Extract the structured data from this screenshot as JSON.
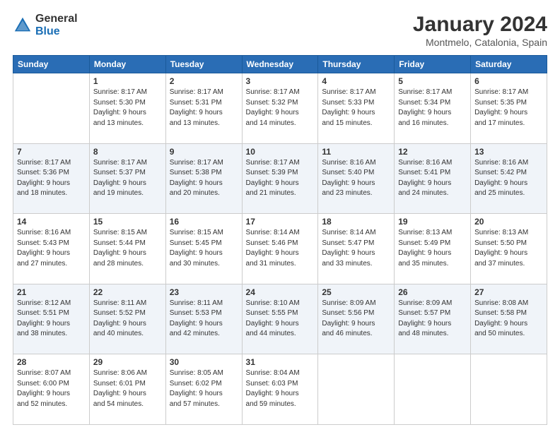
{
  "logo": {
    "general": "General",
    "blue": "Blue"
  },
  "title": "January 2024",
  "subtitle": "Montmelo, Catalonia, Spain",
  "days_header": [
    "Sunday",
    "Monday",
    "Tuesday",
    "Wednesday",
    "Thursday",
    "Friday",
    "Saturday"
  ],
  "weeks": [
    [
      {
        "num": "",
        "sunrise": "",
        "sunset": "",
        "daylight": "",
        "empty": true
      },
      {
        "num": "1",
        "sunrise": "Sunrise: 8:17 AM",
        "sunset": "Sunset: 5:30 PM",
        "daylight": "Daylight: 9 hours and 13 minutes."
      },
      {
        "num": "2",
        "sunrise": "Sunrise: 8:17 AM",
        "sunset": "Sunset: 5:31 PM",
        "daylight": "Daylight: 9 hours and 13 minutes."
      },
      {
        "num": "3",
        "sunrise": "Sunrise: 8:17 AM",
        "sunset": "Sunset: 5:32 PM",
        "daylight": "Daylight: 9 hours and 14 minutes."
      },
      {
        "num": "4",
        "sunrise": "Sunrise: 8:17 AM",
        "sunset": "Sunset: 5:33 PM",
        "daylight": "Daylight: 9 hours and 15 minutes."
      },
      {
        "num": "5",
        "sunrise": "Sunrise: 8:17 AM",
        "sunset": "Sunset: 5:34 PM",
        "daylight": "Daylight: 9 hours and 16 minutes."
      },
      {
        "num": "6",
        "sunrise": "Sunrise: 8:17 AM",
        "sunset": "Sunset: 5:35 PM",
        "daylight": "Daylight: 9 hours and 17 minutes."
      }
    ],
    [
      {
        "num": "7",
        "sunrise": "Sunrise: 8:17 AM",
        "sunset": "Sunset: 5:36 PM",
        "daylight": "Daylight: 9 hours and 18 minutes."
      },
      {
        "num": "8",
        "sunrise": "Sunrise: 8:17 AM",
        "sunset": "Sunset: 5:37 PM",
        "daylight": "Daylight: 9 hours and 19 minutes."
      },
      {
        "num": "9",
        "sunrise": "Sunrise: 8:17 AM",
        "sunset": "Sunset: 5:38 PM",
        "daylight": "Daylight: 9 hours and 20 minutes."
      },
      {
        "num": "10",
        "sunrise": "Sunrise: 8:17 AM",
        "sunset": "Sunset: 5:39 PM",
        "daylight": "Daylight: 9 hours and 21 minutes."
      },
      {
        "num": "11",
        "sunrise": "Sunrise: 8:16 AM",
        "sunset": "Sunset: 5:40 PM",
        "daylight": "Daylight: 9 hours and 23 minutes."
      },
      {
        "num": "12",
        "sunrise": "Sunrise: 8:16 AM",
        "sunset": "Sunset: 5:41 PM",
        "daylight": "Daylight: 9 hours and 24 minutes."
      },
      {
        "num": "13",
        "sunrise": "Sunrise: 8:16 AM",
        "sunset": "Sunset: 5:42 PM",
        "daylight": "Daylight: 9 hours and 25 minutes."
      }
    ],
    [
      {
        "num": "14",
        "sunrise": "Sunrise: 8:16 AM",
        "sunset": "Sunset: 5:43 PM",
        "daylight": "Daylight: 9 hours and 27 minutes."
      },
      {
        "num": "15",
        "sunrise": "Sunrise: 8:15 AM",
        "sunset": "Sunset: 5:44 PM",
        "daylight": "Daylight: 9 hours and 28 minutes."
      },
      {
        "num": "16",
        "sunrise": "Sunrise: 8:15 AM",
        "sunset": "Sunset: 5:45 PM",
        "daylight": "Daylight: 9 hours and 30 minutes."
      },
      {
        "num": "17",
        "sunrise": "Sunrise: 8:14 AM",
        "sunset": "Sunset: 5:46 PM",
        "daylight": "Daylight: 9 hours and 31 minutes."
      },
      {
        "num": "18",
        "sunrise": "Sunrise: 8:14 AM",
        "sunset": "Sunset: 5:47 PM",
        "daylight": "Daylight: 9 hours and 33 minutes."
      },
      {
        "num": "19",
        "sunrise": "Sunrise: 8:13 AM",
        "sunset": "Sunset: 5:49 PM",
        "daylight": "Daylight: 9 hours and 35 minutes."
      },
      {
        "num": "20",
        "sunrise": "Sunrise: 8:13 AM",
        "sunset": "Sunset: 5:50 PM",
        "daylight": "Daylight: 9 hours and 37 minutes."
      }
    ],
    [
      {
        "num": "21",
        "sunrise": "Sunrise: 8:12 AM",
        "sunset": "Sunset: 5:51 PM",
        "daylight": "Daylight: 9 hours and 38 minutes."
      },
      {
        "num": "22",
        "sunrise": "Sunrise: 8:11 AM",
        "sunset": "Sunset: 5:52 PM",
        "daylight": "Daylight: 9 hours and 40 minutes."
      },
      {
        "num": "23",
        "sunrise": "Sunrise: 8:11 AM",
        "sunset": "Sunset: 5:53 PM",
        "daylight": "Daylight: 9 hours and 42 minutes."
      },
      {
        "num": "24",
        "sunrise": "Sunrise: 8:10 AM",
        "sunset": "Sunset: 5:55 PM",
        "daylight": "Daylight: 9 hours and 44 minutes."
      },
      {
        "num": "25",
        "sunrise": "Sunrise: 8:09 AM",
        "sunset": "Sunset: 5:56 PM",
        "daylight": "Daylight: 9 hours and 46 minutes."
      },
      {
        "num": "26",
        "sunrise": "Sunrise: 8:09 AM",
        "sunset": "Sunset: 5:57 PM",
        "daylight": "Daylight: 9 hours and 48 minutes."
      },
      {
        "num": "27",
        "sunrise": "Sunrise: 8:08 AM",
        "sunset": "Sunset: 5:58 PM",
        "daylight": "Daylight: 9 hours and 50 minutes."
      }
    ],
    [
      {
        "num": "28",
        "sunrise": "Sunrise: 8:07 AM",
        "sunset": "Sunset: 6:00 PM",
        "daylight": "Daylight: 9 hours and 52 minutes."
      },
      {
        "num": "29",
        "sunrise": "Sunrise: 8:06 AM",
        "sunset": "Sunset: 6:01 PM",
        "daylight": "Daylight: 9 hours and 54 minutes."
      },
      {
        "num": "30",
        "sunrise": "Sunrise: 8:05 AM",
        "sunset": "Sunset: 6:02 PM",
        "daylight": "Daylight: 9 hours and 57 minutes."
      },
      {
        "num": "31",
        "sunrise": "Sunrise: 8:04 AM",
        "sunset": "Sunset: 6:03 PM",
        "daylight": "Daylight: 9 hours and 59 minutes."
      },
      {
        "num": "",
        "sunrise": "",
        "sunset": "",
        "daylight": "",
        "empty": true
      },
      {
        "num": "",
        "sunrise": "",
        "sunset": "",
        "daylight": "",
        "empty": true
      },
      {
        "num": "",
        "sunrise": "",
        "sunset": "",
        "daylight": "",
        "empty": true
      }
    ]
  ]
}
